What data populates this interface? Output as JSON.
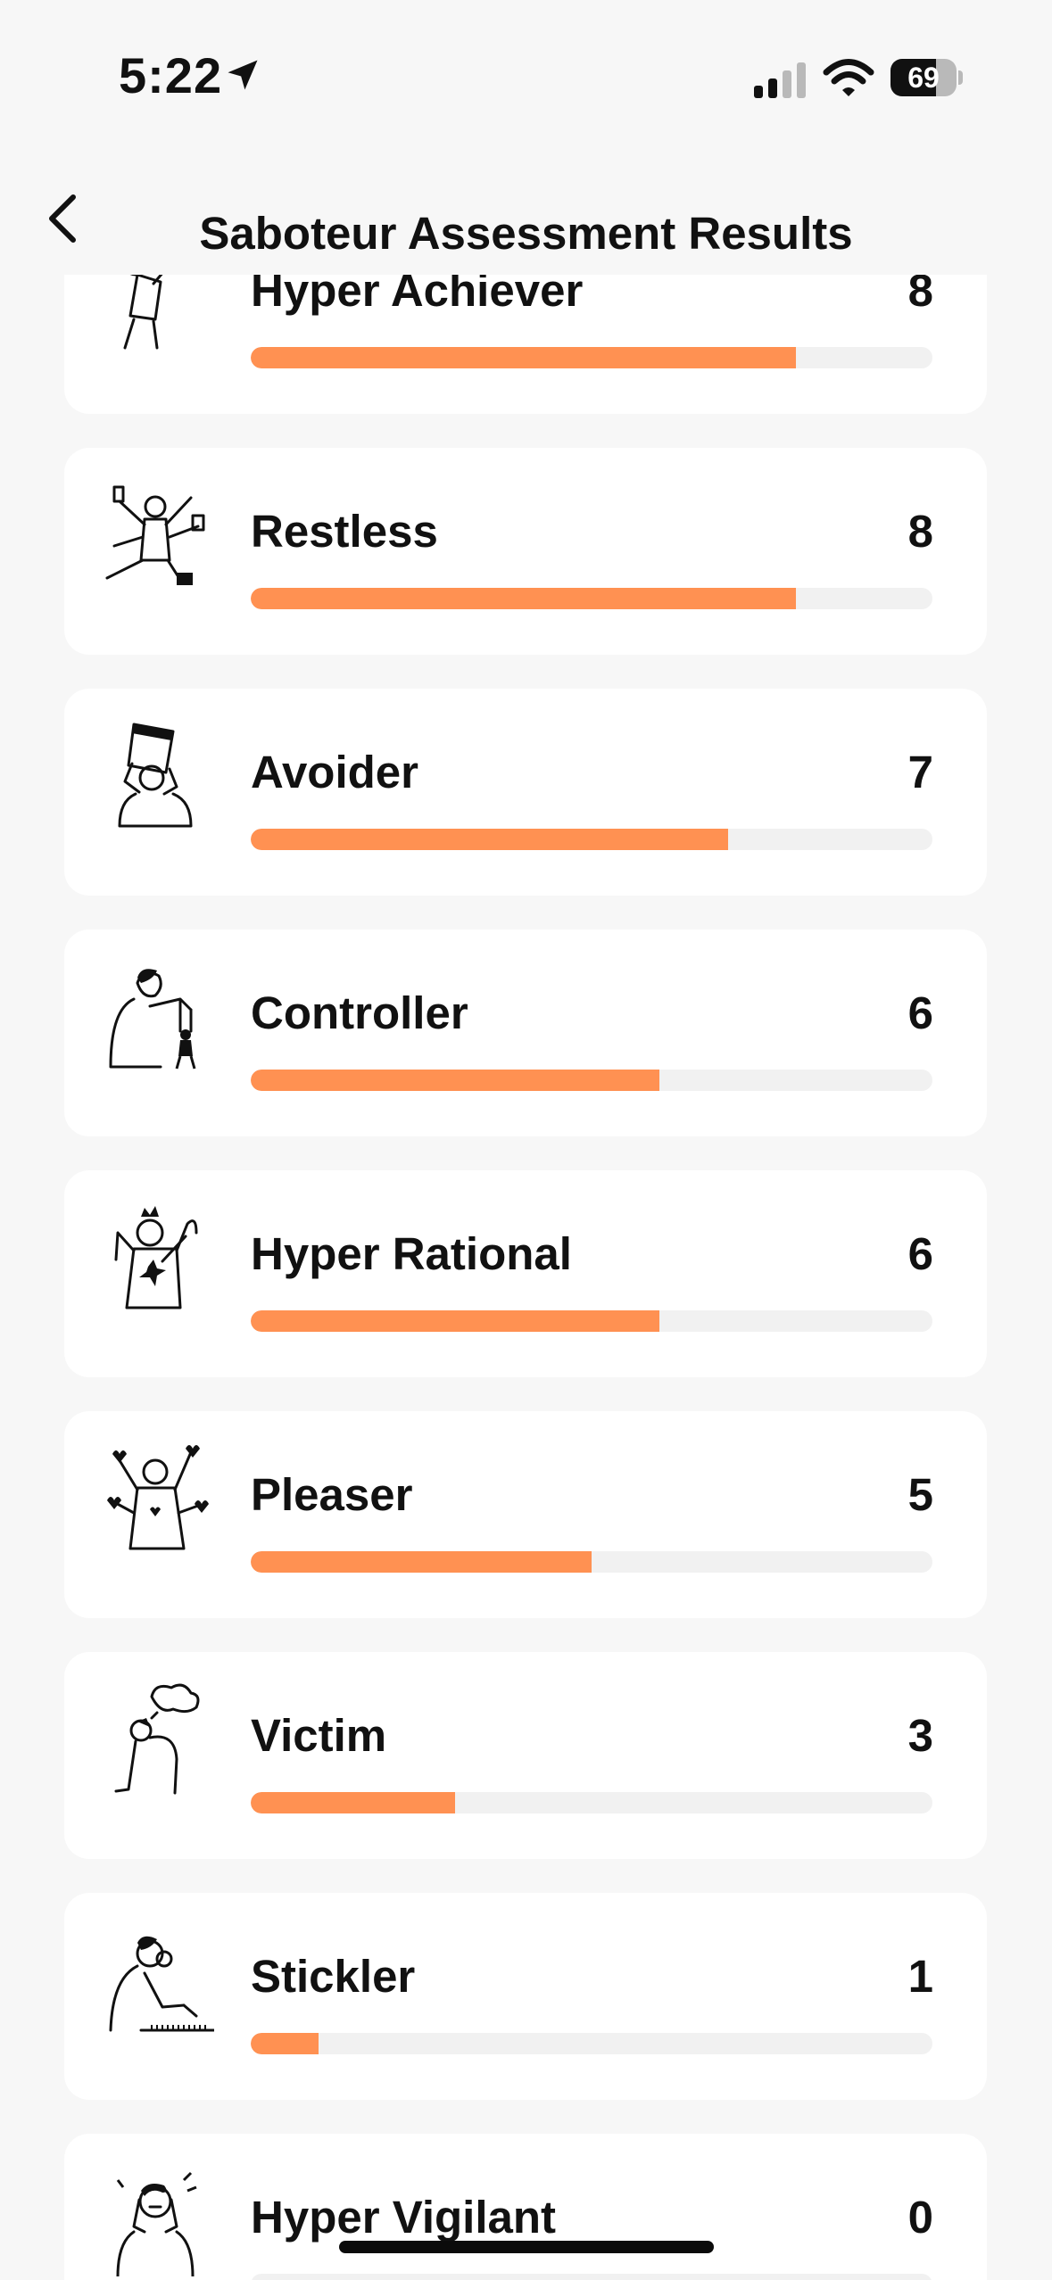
{
  "status_bar": {
    "time": "5:22",
    "battery": "69",
    "battery_level": 0.69
  },
  "header": {
    "title": "Saboteur Assessment Results"
  },
  "max_score": 10,
  "saboteurs": [
    {
      "name": "Hyper Achiever",
      "score": "8",
      "icon": "hyper-achiever-illustration"
    },
    {
      "name": "Restless",
      "score": "8",
      "icon": "restless-illustration"
    },
    {
      "name": "Avoider",
      "score": "7",
      "icon": "avoider-illustration"
    },
    {
      "name": "Controller",
      "score": "6",
      "icon": "controller-illustration"
    },
    {
      "name": "Hyper Rational",
      "score": "6",
      "icon": "hyper-rational-illustration"
    },
    {
      "name": "Pleaser",
      "score": "5",
      "icon": "pleaser-illustration"
    },
    {
      "name": "Victim",
      "score": "3",
      "icon": "victim-illustration"
    },
    {
      "name": "Stickler",
      "score": "1",
      "icon": "stickler-illustration"
    },
    {
      "name": "Hyper Vigilant",
      "score": "0",
      "icon": "hyper-vigilant-illustration"
    }
  ],
  "colors": {
    "progress_fill": "#ff9152",
    "progress_track": "#f1f1f1",
    "card_background": "#ffffff",
    "page_background": "#f7f7f7"
  }
}
